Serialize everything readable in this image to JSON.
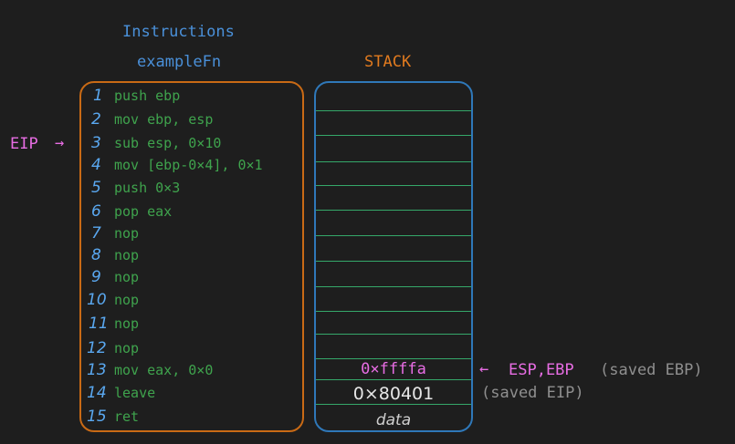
{
  "header": {
    "title": "Instructions",
    "function_name": "exampleFn",
    "stack_title": "STACK"
  },
  "instructions": [
    {
      "num": "1",
      "code": "push ebp"
    },
    {
      "num": "2",
      "code": "mov ebp, esp"
    },
    {
      "num": "3",
      "code": "sub esp, 0×10"
    },
    {
      "num": "4",
      "code": "mov [ebp-0×4], 0×1"
    },
    {
      "num": "5",
      "code": "push 0×3"
    },
    {
      "num": "6",
      "code": "pop eax"
    },
    {
      "num": "7",
      "code": "nop"
    },
    {
      "num": "8",
      "code": "nop"
    },
    {
      "num": "9",
      "code": "nop"
    },
    {
      "num": "10",
      "code": "nop"
    },
    {
      "num": "11",
      "code": "nop"
    },
    {
      "num": "12",
      "code": "nop"
    },
    {
      "num": "13",
      "code": "mov eax, 0×0"
    },
    {
      "num": "14",
      "code": "leave"
    },
    {
      "num": "15",
      "code": "ret"
    }
  ],
  "eip": {
    "label": "EIP",
    "arrow": "→"
  },
  "stack": {
    "slots": [
      "0×ffffa",
      "0×80401",
      "data"
    ],
    "esp_ebp": {
      "arrow": "←",
      "label": "ESP,EBP",
      "note": "(saved EBP)"
    },
    "saved_eip_note": "(saved EIP)"
  },
  "colors": {
    "background": "#1e1e1e",
    "instructions_box": "#c96a15",
    "stack_box": "#2f78b9",
    "line_numbers": "#5aa8f0",
    "code": "#3fa34d",
    "pointer": "#e86de4",
    "note": "#8f8f8f"
  }
}
